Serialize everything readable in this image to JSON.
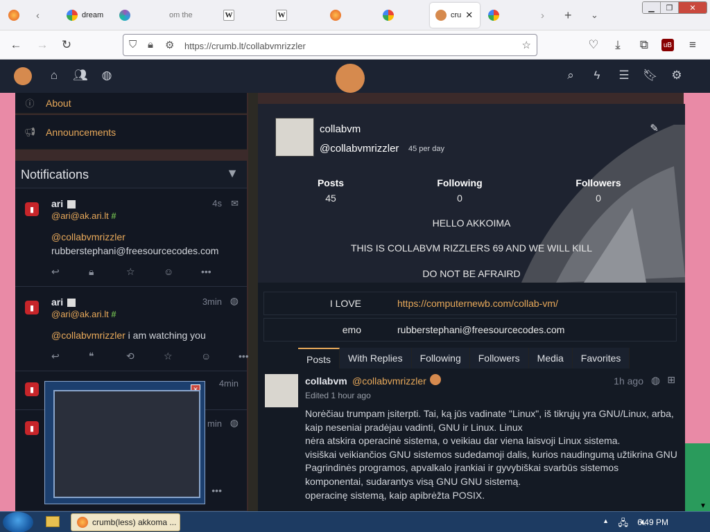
{
  "browser": {
    "tabs": [
      {
        "label": "",
        "icon": "firefox-icon"
      },
      {
        "label": "",
        "icon": "back-arrow-icon"
      },
      {
        "label": "dream",
        "icon": "google-icon"
      },
      {
        "label": "om the",
        "icon": "generic-site-icon"
      },
      {
        "label": "",
        "icon": "wikipedia-icon"
      },
      {
        "label": "",
        "icon": "wikipedia-icon"
      },
      {
        "label": "",
        "icon": "firefox-icon"
      },
      {
        "label": "",
        "icon": "google-icon"
      },
      {
        "label": "cru",
        "icon": "cookie-icon"
      },
      {
        "label": "",
        "icon": "google-icon"
      }
    ],
    "url": "https://crumb.lt/collabvmrizzler",
    "url_host": "crumb.lt",
    "url_path": "/collabvmrizzler"
  },
  "left": {
    "menu": [
      {
        "label": "About",
        "icon": "info-icon"
      },
      {
        "label": "Announcements",
        "icon": "megaphone-icon"
      }
    ],
    "notifications_title": "Notifications",
    "notifications": [
      {
        "name": "ari",
        "account": "@ari@ak.ari.lt",
        "time": "4s",
        "mention": "@collabvmrizzler",
        "body": "rubberstephani@freesourcecodes.com"
      },
      {
        "name": "ari",
        "account": "@ari@ak.ari.lt",
        "time": "3min",
        "mention": "@collabvmrizzler",
        "body": " i am watching you"
      },
      {
        "time": "4min"
      },
      {
        "time": "min"
      }
    ]
  },
  "profile": {
    "display_name": "collabvm",
    "handle": "@collabvmrizzler",
    "rate": "45 per day",
    "stats": [
      {
        "label": "Posts",
        "value": "45"
      },
      {
        "label": "Following",
        "value": "0"
      },
      {
        "label": "Followers",
        "value": "0"
      }
    ],
    "bio": [
      "HELLO AKKOIMA",
      "THIS IS COLLABVM RIZZLERS 69 AND WE WILL KILL",
      "DO NOT BE AFRAIRD"
    ],
    "fields": [
      {
        "key": "I LOVE",
        "value": "https://computernewb.com/collab-vm/"
      },
      {
        "key": "emo",
        "value": "rubberstephani@freesourcecodes.com"
      }
    ],
    "tabs": [
      "Posts",
      "With Replies",
      "Following",
      "Followers",
      "Media",
      "Favorites"
    ]
  },
  "post": {
    "name": "collabvm",
    "handle": "@collabvmrizzler",
    "time": "1h ago",
    "edited": "Edited 1 hour ago",
    "lines": [
      "Norėčiau trumpam įsiterpti. Tai, ką jūs vadinate \"Linux\", iš tikrųjų yra GNU/Linux, arba,",
      "kaip neseniai pradėjau vadinti, GNU ir Linux. Linux",
      "nėra atskira operacinė sistema, o veikiau dar viena laisvoji Linux sistema.",
      "visiškai veikiančios GNU sistemos sudedamoji dalis, kurios naudingumą užtikrina GNU",
      "Pagrindinės programos, apvalkalo įrankiai ir gyvybiškai svarbūs sistemos",
      "komponentai, sudarantys visą GNU GNU sistemą.",
      "operacinę sistemą, kaip apibrėžta POSIX."
    ]
  },
  "taskbar": {
    "app_label": "crumb(less) akkoma ...",
    "time": "6:49 PM"
  },
  "colors": {
    "accent": "#e8a95a",
    "panel": "#121722",
    "header": "#1c2332"
  }
}
